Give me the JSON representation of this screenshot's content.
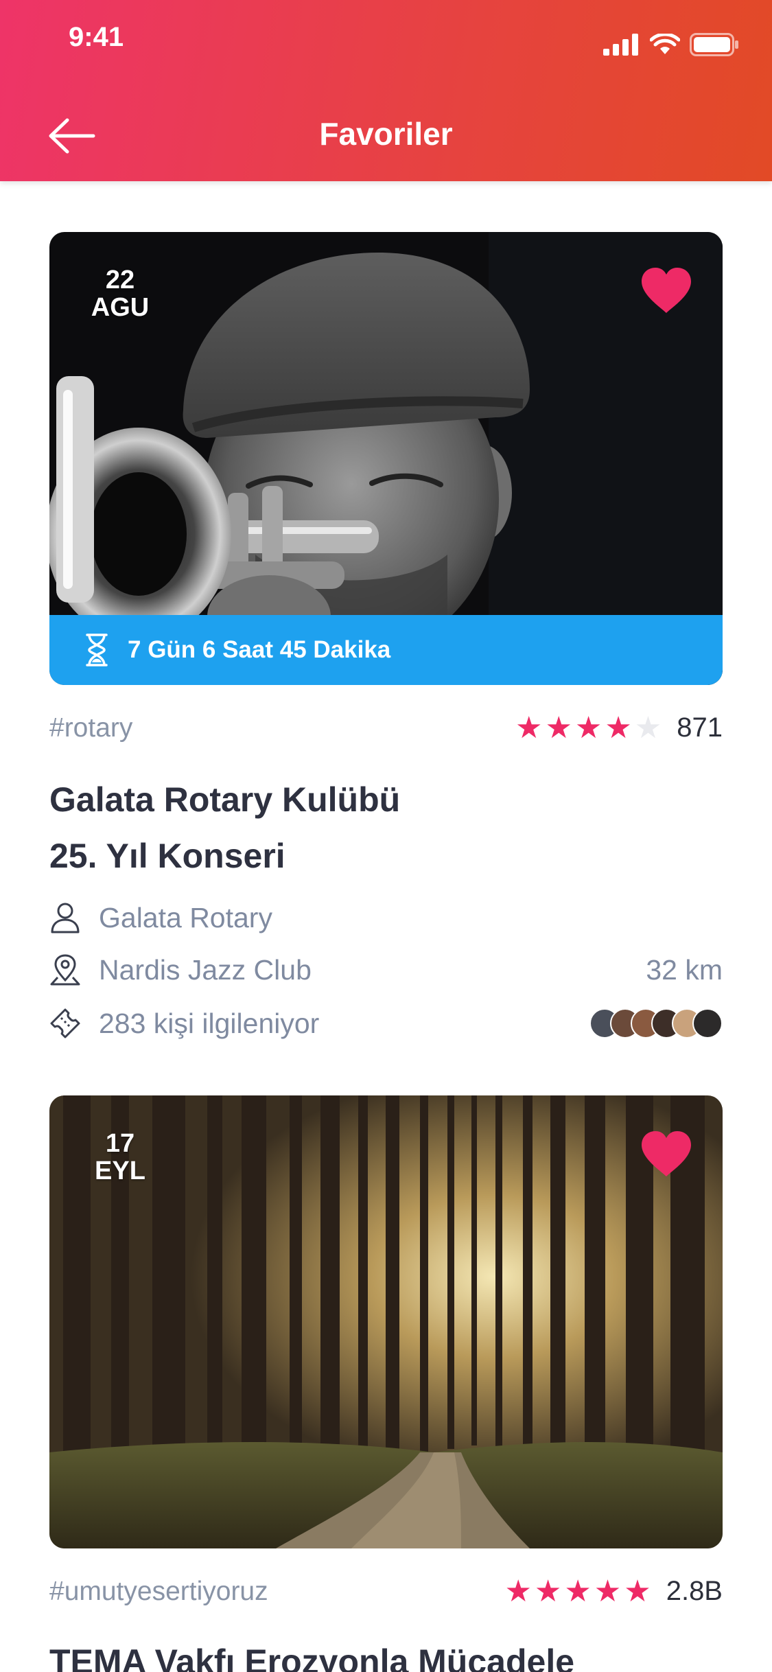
{
  "status_bar": {
    "time": "9:41"
  },
  "header": {
    "title": "Favoriler"
  },
  "events": [
    {
      "date_day": "22",
      "date_month": "AGU",
      "countdown": "7 Gün 6 Saat 45 Dakika",
      "hashtag": "#rotary",
      "rating_stars": 4,
      "rating_count": "871",
      "title_line1": "Galata Rotary Kulübü",
      "title_line2": "25. Yıl Konseri",
      "organizer": "Galata Rotary",
      "venue": "Nardis Jazz Club",
      "distance": "32 km",
      "interested": "283 kişi ilgileniyor",
      "favorited": true
    },
    {
      "date_day": "17",
      "date_month": "EYL",
      "hashtag": "#umutyesertiyoruz",
      "rating_stars": 5,
      "rating_count": "2.8B",
      "title_line1": "TEMA Vakfı Erozyonla Mücadele",
      "favorited": true
    }
  ],
  "colors": {
    "header_gradient_start": "#ee3468",
    "header_gradient_end": "#e24a26",
    "accent_pink": "#ee2a66",
    "countdown_blue": "#1ea1ef",
    "muted_text": "#7f8aa0",
    "title_text": "#2e3140"
  },
  "icons": {
    "back": "arrow-left-icon",
    "favorite": "heart-icon",
    "countdown": "hourglass-icon",
    "organizer": "person-icon",
    "venue": "location-pin-icon",
    "interested": "ticket-icon"
  }
}
